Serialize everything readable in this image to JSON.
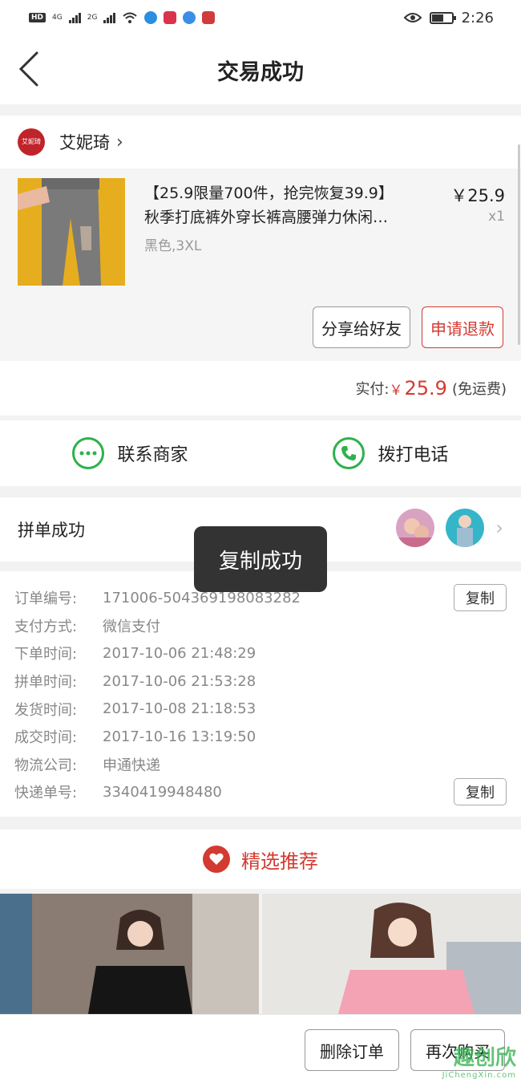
{
  "status_bar": {
    "badge": "HD",
    "net1": "4G",
    "net2": "2G",
    "time": "2:26",
    "battery_level": 0.6
  },
  "nav": {
    "title": "交易成功"
  },
  "store": {
    "name": "艾妮琦",
    "logo_text": "艾妮琦"
  },
  "product": {
    "title_line1": "【25.9限量700件，抢完恢复39.9】",
    "title_line2": "秋季打底裤外穿长裤高腰弹力休闲…",
    "spec": "黑色,3XL",
    "price": "￥25.9",
    "qty": "x1"
  },
  "actions": {
    "share": "分享给好友",
    "refund": "申请退款"
  },
  "payment": {
    "label": "实付:",
    "currency": "￥",
    "amount": "25.9",
    "note": "(免运费)"
  },
  "contact": {
    "merchant": "联系商家",
    "call": "拨打电话"
  },
  "group": {
    "label": "拼单成功"
  },
  "toast": "复制成功",
  "details": {
    "copy_label": "复制",
    "rows": [
      {
        "k": "订单编号:",
        "v": "171006-504369198083282"
      },
      {
        "k": "支付方式:",
        "v": "微信支付"
      },
      {
        "k": "下单时间:",
        "v": "2017-10-06 21:48:29"
      },
      {
        "k": "拼单时间:",
        "v": "2017-10-06 21:53:28"
      },
      {
        "k": "发货时间:",
        "v": "2017-10-08 21:18:53"
      },
      {
        "k": "成交时间:",
        "v": "2017-10-16 13:19:50"
      },
      {
        "k": "物流公司:",
        "v": "申通快递"
      },
      {
        "k": "快递单号:",
        "v": "3340419948480"
      }
    ]
  },
  "recommend": {
    "title": "精选推荐"
  },
  "bottom": {
    "delete": "删除订单",
    "rebuy": "再次购买"
  },
  "watermark": {
    "main": "趣创欣",
    "sub": "JiChengXin.com"
  },
  "colors": {
    "accent": "#d33a31",
    "green": "#2fb14c"
  }
}
